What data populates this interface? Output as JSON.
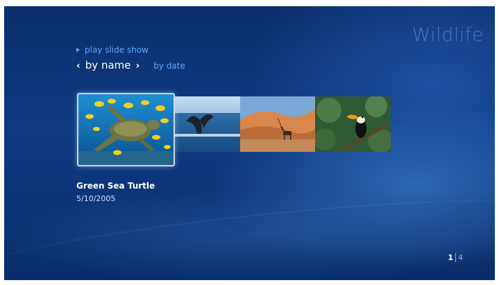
{
  "gallery": {
    "title": "Wildlife",
    "actions": {
      "slideshow_label": "play slide show"
    },
    "sort": {
      "active_label": "by name",
      "prev_glyph": "‹",
      "next_glyph": "›",
      "other_label": "by date"
    },
    "items": [
      {
        "subject": "green sea turtle and yellow reef fish",
        "selected": true
      },
      {
        "subject": "whale tail above ocean",
        "selected": false
      },
      {
        "subject": "oryx on desert sand dunes",
        "selected": false
      },
      {
        "subject": "toucan on a branch",
        "selected": false
      }
    ],
    "selected": {
      "title": "Green Sea Turtle",
      "date": "5/10/2005"
    },
    "pager": {
      "current": "1",
      "total": "4"
    }
  },
  "colors": {
    "background": "#0d3a82",
    "accent_link": "#5aa8ff",
    "title_text": "#ffffff"
  },
  "icons": {
    "slideshow": "play-triangle",
    "sort_prev": "chevron-left",
    "sort_next": "chevron-right"
  }
}
